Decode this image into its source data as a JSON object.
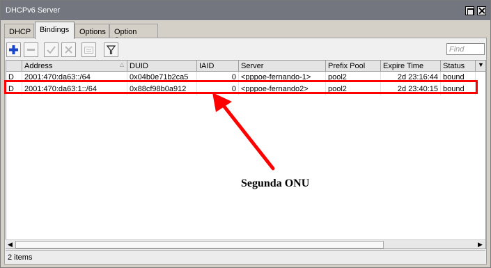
{
  "window": {
    "title": "DHCPv6 Server"
  },
  "tabs": [
    {
      "label": "DHCP"
    },
    {
      "label": "Bindings"
    },
    {
      "label": "Options"
    },
    {
      "label": "Option Sets"
    }
  ],
  "toolbar": {
    "add_icon": "plus-icon",
    "remove_icon": "minus-icon",
    "enable_icon": "check-icon",
    "disable_icon": "x-icon",
    "comment_icon": "comment-icon",
    "filter_icon": "filter-icon",
    "find_placeholder": "Find"
  },
  "table": {
    "columns": [
      "",
      "Address",
      "DUID",
      "IAID",
      "Server",
      "Prefix Pool",
      "Expire Time",
      "Status"
    ],
    "rows": [
      {
        "flag": "D",
        "address": "2001:470:da63::/64",
        "duid": "0x04b0e71b2ca5",
        "iaid": "0",
        "server": "<pppoe-fernando-1>",
        "pool": "pool2",
        "expire": "2d 23:16:44",
        "status": "bound"
      },
      {
        "flag": "D",
        "address": "2001:470:da63:1::/64",
        "duid": "0x88cf98b0a912",
        "iaid": "0",
        "server": "<pppoe-fernando2>",
        "pool": "pool2",
        "expire": "2d 23:40:15",
        "status": "bound"
      }
    ]
  },
  "status_bar": {
    "text": "2 items"
  },
  "annotation": {
    "text": "Segunda ONU",
    "highlight_color": "#ff0000",
    "arrow_color": "#ff0000"
  }
}
